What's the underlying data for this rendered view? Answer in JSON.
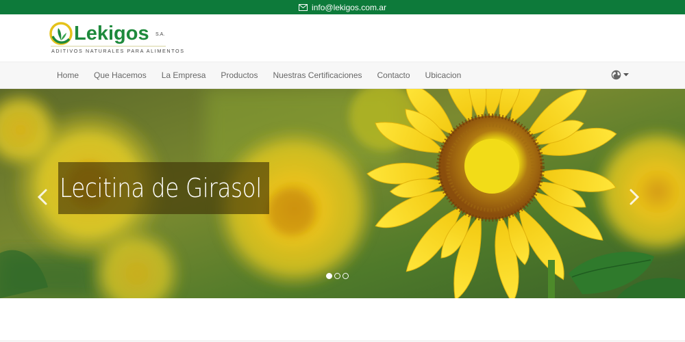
{
  "topbar": {
    "email": "info@lekigos.com.ar",
    "icon": "envelope-icon",
    "bg_color": "#0d7a3a"
  },
  "brand": {
    "name": "Lekigos",
    "suffix": "S.A.",
    "tagline": "ADITIVOS NATURALES PARA ALIMENTOS",
    "color": "#1e8a3c"
  },
  "nav": {
    "items": [
      "Home",
      "Que Hacemos",
      "La Empresa",
      "Productos",
      "Nuestras Certificaciones",
      "Contacto",
      "Ubicacion"
    ],
    "language_icon": "globe-icon"
  },
  "carousel": {
    "caption": "Lecitina de Girasol",
    "slide_count": 3,
    "active_slide": 1,
    "prev_icon": "chevron-left-icon",
    "next_icon": "chevron-right-icon"
  }
}
